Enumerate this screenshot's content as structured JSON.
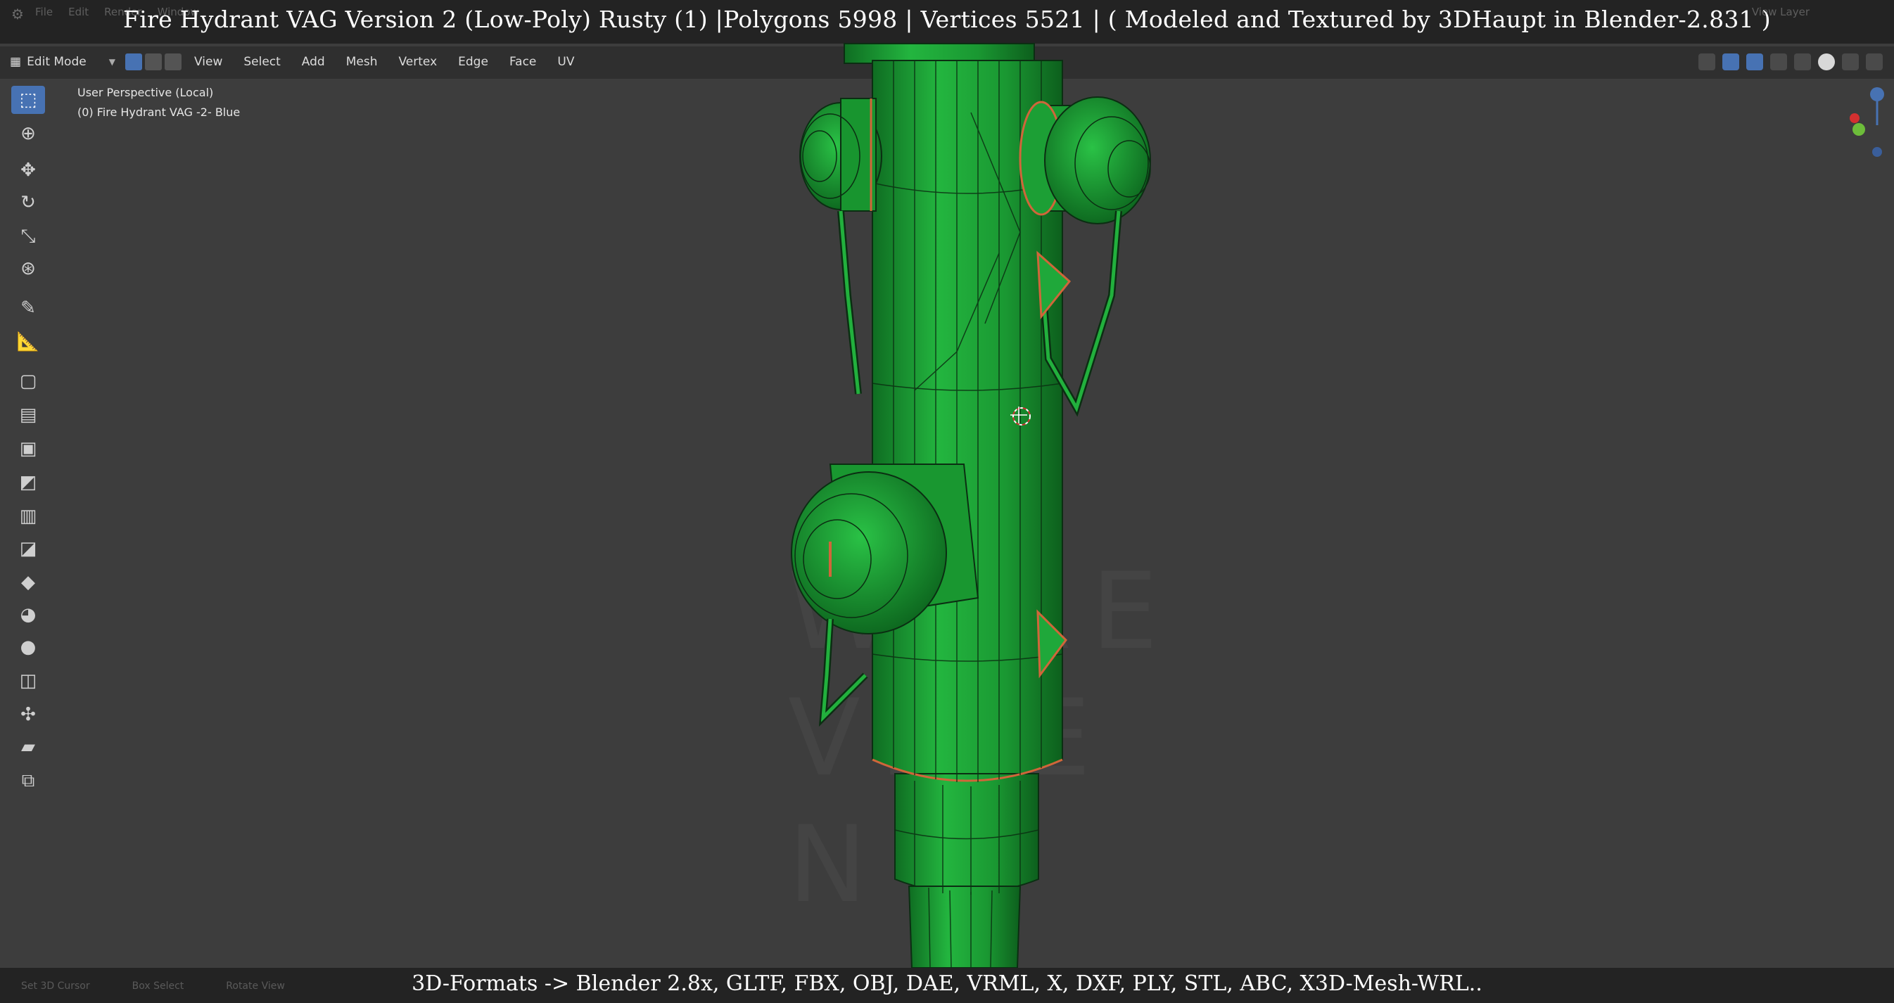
{
  "title_overlay": "Fire Hydrant VAG Version 2 (Low-Poly) Rusty (1) |Polygons 5998 | Vertices 5521 | ( Modeled and Textured by 3DHaupt in Blender-2.831 )",
  "top_menu": [
    "File",
    "Edit",
    "Render",
    "Window"
  ],
  "view_layer": "View Layer",
  "header": {
    "mode": "Edit Mode",
    "menu": [
      "View",
      "Select",
      "Add",
      "Mesh",
      "Vertex",
      "Edge",
      "Face",
      "UV"
    ]
  },
  "viewport": {
    "perspective": "User Perspective (Local)",
    "object_name": "(0) Fire Hydrant VAG -2- Blue"
  },
  "watermark": [
    "WARE",
    "VICE",
    "N"
  ],
  "tools": [
    "select-box",
    "cursor",
    "move",
    "rotate",
    "scale",
    "transform",
    "annotate",
    "measure",
    "add-cube",
    "extrude",
    "inset",
    "bevel",
    "loop-cut",
    "knife",
    "poly-build",
    "spin",
    "smooth",
    "edge-slide",
    "shrink-fatten",
    "shear",
    "rip"
  ],
  "status_bar": [
    "Set 3D Cursor",
    "Box Select",
    "Rotate View"
  ],
  "formats_overlay": "3D-Formats -> Blender 2.8x, GLTF, FBX, OBJ, DAE, VRML, X, DXF, PLY, STL, ABC, X3D-Mesh-WRL..",
  "colors": {
    "mesh_green": "#1fa83a",
    "wire": "#0b2e12",
    "seam": "#d0663a",
    "active": "#4772b3"
  }
}
